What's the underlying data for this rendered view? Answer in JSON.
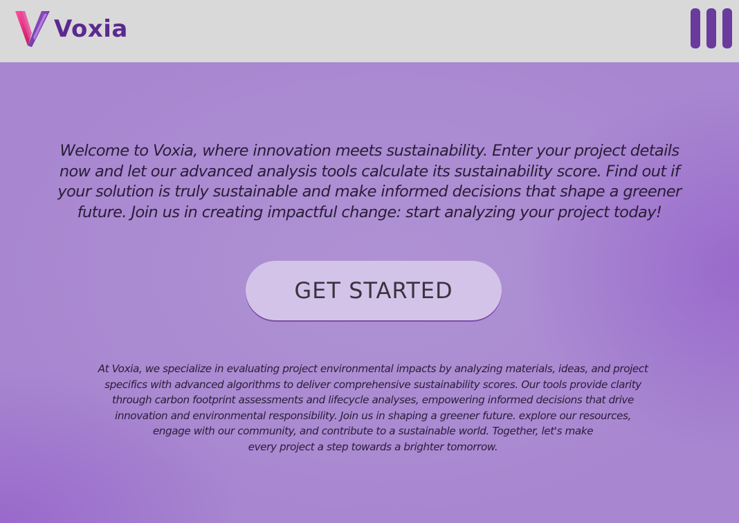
{
  "header": {
    "logo_text": "Voxia",
    "logo_icon": "voxia-v-logo-icon",
    "menu_icon": "hamburger-menu-icon"
  },
  "main": {
    "welcome_text": "Welcome to Voxia, where innovation meets sustainability. Enter your project details now and let our advanced analysis tools calculate its sustainability score. Find out if your solution is truly sustainable and make informed decisions that shape a greener future. Join us in creating impactful change: start analyzing your project today!",
    "cta_label": "GET STARTED",
    "about_text": "At Voxia, we specialize in evaluating project environmental impacts by analyzing materials, ideas, and project\nspecifics with advanced algorithms to deliver comprehensive sustainability scores. Our tools provide clarity\nthrough carbon footprint assessments and lifecycle analyses, empowering informed decisions that drive\ninnovation and environmental responsibility. Join us in shaping a greener future. explore our resources,\nengage with our community, and contribute to a sustainable world. Together, let's make\nevery project a step towards a brighter tomorrow."
  },
  "colors": {
    "header_bg": "#d9d9d9",
    "brand_purple": "#5b2a8f",
    "menu_purple": "#6a3a9c",
    "page_bg": "#a887d0",
    "button_bg": "#d4c3e8"
  }
}
